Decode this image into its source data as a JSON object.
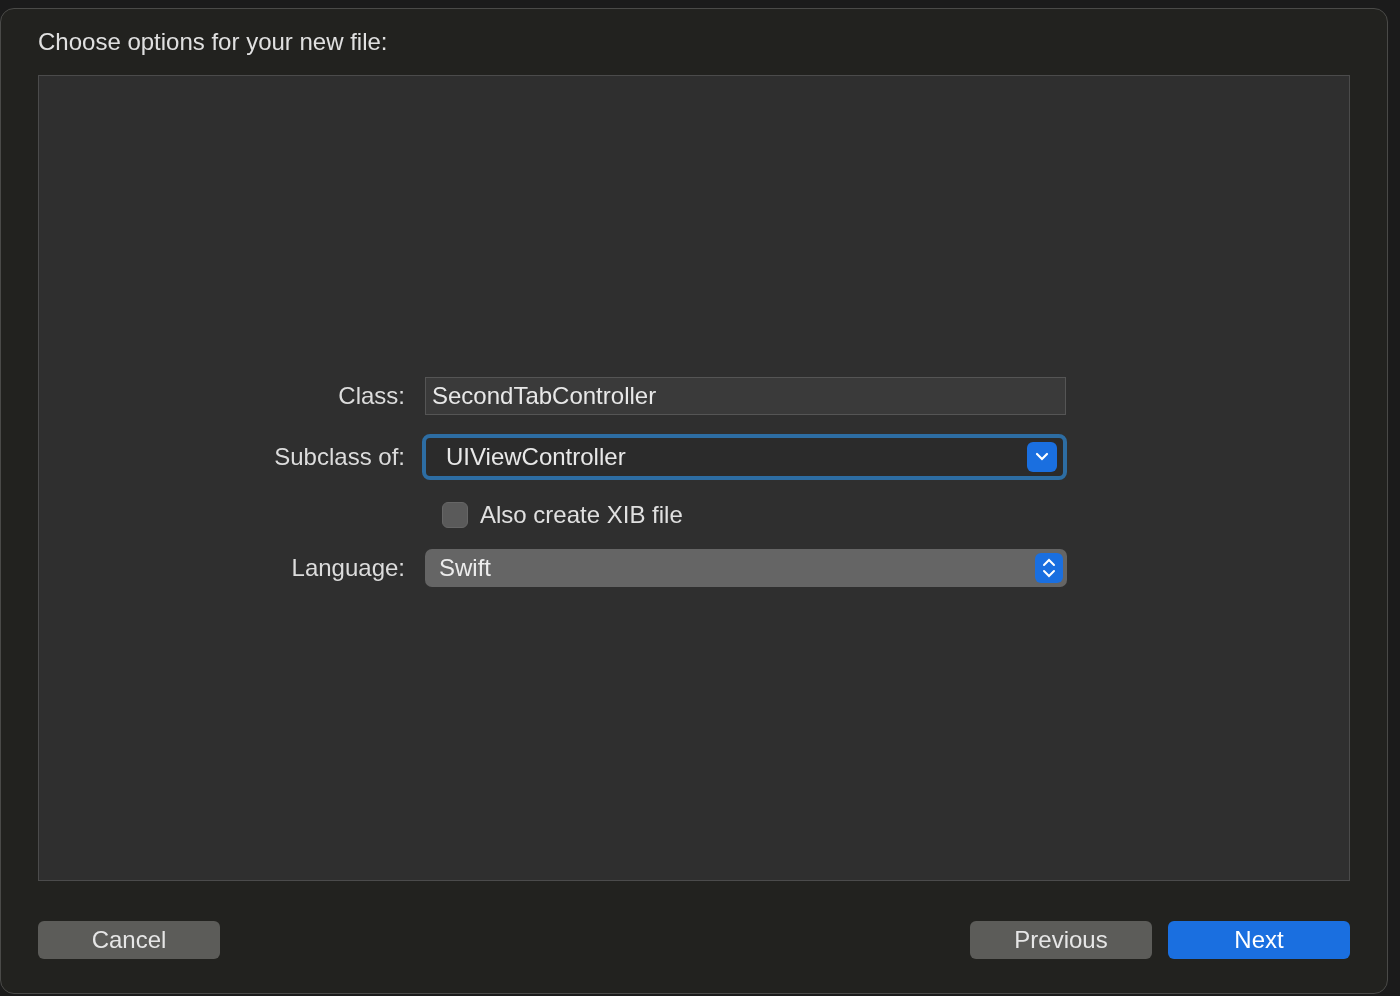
{
  "dialog": {
    "title": "Choose options for your new file:"
  },
  "form": {
    "class_field": {
      "label": "Class:",
      "value": "SecondTabController"
    },
    "subclass_field": {
      "label": "Subclass of:",
      "value": "UIViewController",
      "focused": true
    },
    "xib_checkbox": {
      "label": "Also create XIB file",
      "checked": false
    },
    "language_popup": {
      "label": "Language:",
      "value": "Swift"
    }
  },
  "left_buttons": [
    {
      "label": "Cancel",
      "kind": "default"
    }
  ],
  "right_buttons": [
    {
      "label": "Previous",
      "kind": "default"
    },
    {
      "label": "Next",
      "kind": "primary"
    }
  ]
}
